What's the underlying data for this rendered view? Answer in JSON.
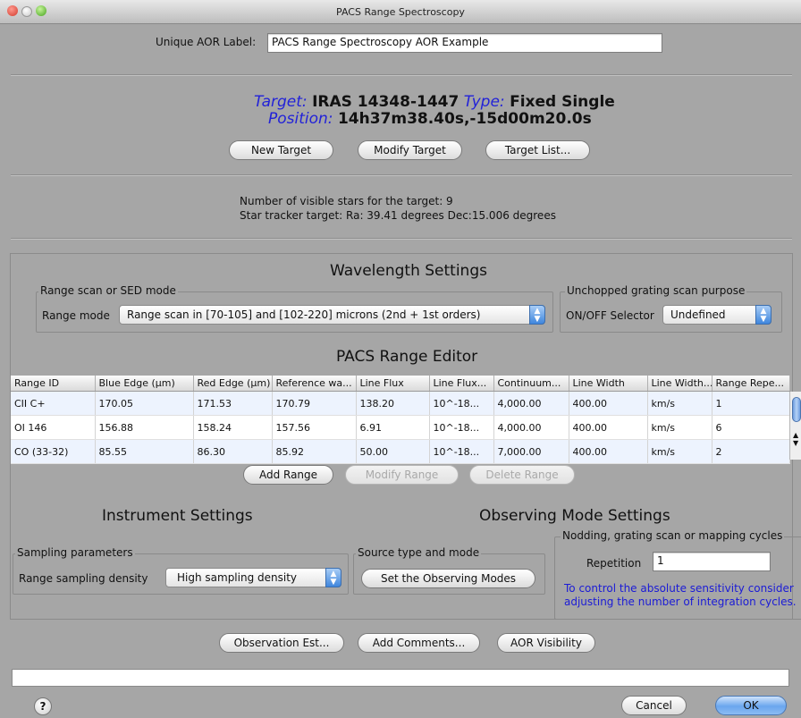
{
  "window": {
    "title": "PACS Range Spectroscopy"
  },
  "aor": {
    "label_caption": "Unique AOR Label:",
    "label_value": "PACS Range Spectroscopy AOR Example"
  },
  "target": {
    "target_caption": "Target:",
    "target_value": "IRAS 14348-1447",
    "type_caption": "Type:",
    "type_value": "Fixed Single",
    "position_caption": "Position:",
    "position_value": "14h37m38.40s,-15d00m20.0s"
  },
  "target_buttons": {
    "new": "New Target",
    "modify": "Modify Target",
    "list": "Target List..."
  },
  "visibility": {
    "stars": "Number of visible stars for the target: 9",
    "tracker": "Star tracker target: Ra: 39.41 degrees Dec:15.006 degrees"
  },
  "wavelength": {
    "heading": "Wavelength Settings",
    "range_group": "Range scan or SED mode",
    "range_mode_label": "Range mode",
    "range_mode_value": "Range scan in [70-105] and [102-220] microns (2nd + 1st orders)",
    "unchopped_group": "Unchopped grating scan purpose",
    "onoff_label": "ON/OFF Selector",
    "onoff_value": "Undefined"
  },
  "editor": {
    "heading": "PACS Range Editor",
    "columns": [
      "Range ID",
      "Blue Edge (µm)",
      "Red Edge (µm)",
      "Reference wa...",
      "Line Flux",
      "Line Flux...",
      "Continuum...",
      "Line Width",
      "Line Width...",
      "Range Repe..."
    ],
    "rows": [
      [
        "CII C+",
        "170.05",
        "171.53",
        "170.79",
        "138.20",
        "10^-18...",
        "4,000.00",
        "400.00",
        "km/s",
        "1"
      ],
      [
        "OI 146",
        "156.88",
        "158.24",
        "157.56",
        "6.91",
        "10^-18...",
        "4,000.00",
        "400.00",
        "km/s",
        "6"
      ],
      [
        "CO (33-32)",
        "85.55",
        "86.30",
        "85.92",
        "50.00",
        "10^-18...",
        "7,000.00",
        "400.00",
        "km/s",
        "2"
      ]
    ],
    "add": "Add Range",
    "modify": "Modify Range",
    "delete": "Delete Range"
  },
  "instrument": {
    "heading": "Instrument Settings",
    "sampling_group": "Sampling parameters",
    "density_label": "Range sampling density",
    "density_value": "High sampling density",
    "source_group": "Source type and mode",
    "set_modes": "Set the Observing Modes"
  },
  "observing": {
    "heading": "Observing Mode Settings",
    "nodding_group": "Nodding, grating scan or mapping cycles",
    "repetition_label": "Repetition",
    "repetition_value": "1",
    "note_line1": "To control the absolute sensitivity consider",
    "note_line2": "adjusting the number of integration cycles."
  },
  "footer_buttons": {
    "estimate": "Observation Est...",
    "comments": "Add Comments...",
    "visibility": "AOR Visibility"
  },
  "dialog": {
    "help": "?",
    "cancel": "Cancel",
    "ok": "OK"
  }
}
